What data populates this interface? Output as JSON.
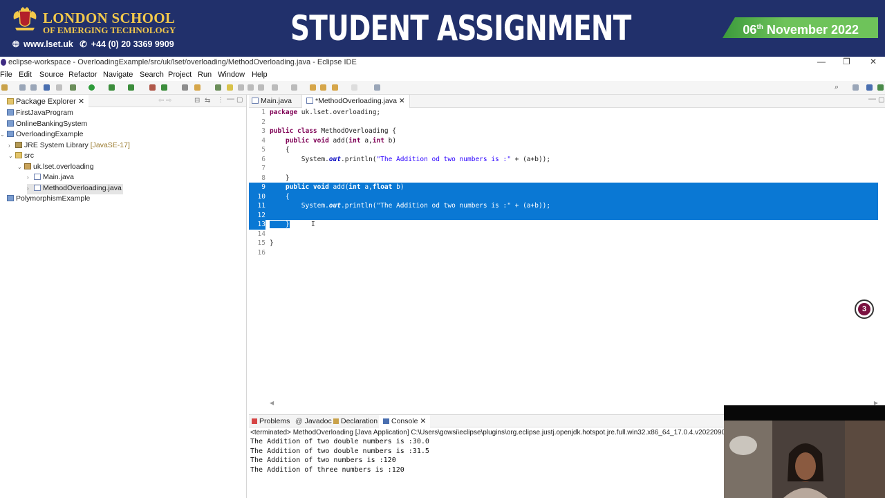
{
  "banner": {
    "logo_line1": "LONDON SCHOOL",
    "logo_line2": "OF EMERGING TECHNOLOGY",
    "website": "www.lset.uk",
    "phone": "+44 (0) 20 3369 9909",
    "title": "STUDENT ASSIGNMENT",
    "date_day": "06",
    "date_suffix": "th",
    "date_rest": "November 2022"
  },
  "window": {
    "title": "eclipse-workspace - OverloadingExample/src/uk/lset/overloading/MethodOverloading.java - Eclipse IDE",
    "minimize": "—",
    "restore": "❐",
    "close": "✕"
  },
  "menu": [
    "File",
    "Edit",
    "Source",
    "Refactor",
    "Navigate",
    "Search",
    "Project",
    "Run",
    "Window",
    "Help"
  ],
  "package_explorer": {
    "tab_label": "Package Explorer",
    "items": [
      {
        "label": "FirstJavaProgram",
        "icon": "project-icon"
      },
      {
        "label": "OnlineBankingSystem",
        "icon": "project-icon"
      },
      {
        "label": "OverloadingExample",
        "icon": "project-icon"
      },
      {
        "label": "JRE System Library",
        "suffix": "[JavaSE-17]",
        "icon": "library-icon"
      },
      {
        "label": "src",
        "icon": "source-folder-icon"
      },
      {
        "label": "uk.lset.overloading",
        "icon": "package-icon"
      },
      {
        "label": "Main.java",
        "icon": "java-file-icon"
      },
      {
        "label": "MethodOverloading.java",
        "icon": "java-file-icon"
      },
      {
        "label": "PolymorphismExample",
        "icon": "project-icon"
      }
    ]
  },
  "editor": {
    "tabs": [
      "Main.java",
      "*MethodOverloading.java"
    ],
    "lines": [
      {
        "n": "1",
        "text": "package uk.lset.overloading;"
      },
      {
        "n": "2",
        "text": ""
      },
      {
        "n": "3",
        "text": "public class MethodOverloading {"
      },
      {
        "n": "4",
        "text": "    public void add(int a,int b)"
      },
      {
        "n": "5",
        "text": "    {"
      },
      {
        "n": "6",
        "text": "        System.out.println(\"The Addition od two numbers is :\" + (a+b));"
      },
      {
        "n": "7",
        "text": ""
      },
      {
        "n": "8",
        "text": "    }"
      },
      {
        "n": "9",
        "text": "    public void add(int a,float b)"
      },
      {
        "n": "10",
        "text": "    {"
      },
      {
        "n": "11",
        "text": "        System.out.println(\"The Addition od two numbers is :\" + (a+b));"
      },
      {
        "n": "12",
        "text": ""
      },
      {
        "n": "13",
        "text": "    }"
      },
      {
        "n": "14",
        "text": ""
      },
      {
        "n": "15",
        "text": "}"
      },
      {
        "n": "16",
        "text": ""
      }
    ],
    "selected_lines": [
      9,
      10,
      11,
      12,
      13
    ]
  },
  "console": {
    "tabs": [
      "Problems",
      "Javadoc",
      "Declaration",
      "Console"
    ],
    "terminated": "<terminated> MethodOverloading [Java Application] C:\\Users\\gowsi\\eclipse\\plugins\\org.eclipse.justj.openjdk.hotspot.jre.full.win32.x86_64_17.0.4.v2022090",
    "output": [
      "The Addition of two double numbers is :30.0",
      "The Addition of two double numbers is :31.5",
      "The Addition of two numbers is :120",
      "The Addition of three numbers is :120"
    ]
  },
  "notification_count": "3",
  "colors": {
    "banner_bg": "#21306b",
    "logo_gold": "#f3c94b",
    "date_green": "#6ec35a",
    "selection": "#0a78d4",
    "keyword": "#7f0055",
    "string": "#2a00ff"
  }
}
